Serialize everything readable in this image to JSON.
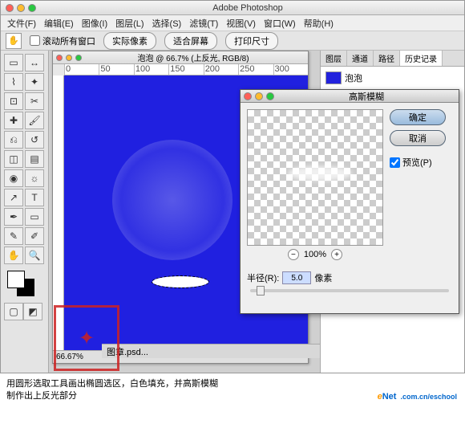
{
  "app": {
    "title": "Adobe Photoshop"
  },
  "menu": [
    "文件(F)",
    "编辑(E)",
    "图像(I)",
    "图层(L)",
    "选择(S)",
    "滤镜(T)",
    "视图(V)",
    "窗口(W)",
    "帮助(H)"
  ],
  "options": {
    "scroll_all": "滚动所有窗口",
    "actual_px": "实际像素",
    "fit_screen": "适合屏幕",
    "print_size": "打印尺寸"
  },
  "doc": {
    "title": "泡泡 @ 66.7% (上反光, RGB/8)",
    "ruler": [
      "0",
      "50",
      "100",
      "150",
      "200",
      "250",
      "300"
    ],
    "zoom_status": "66.67%",
    "tab": "图章.psd..."
  },
  "panels": {
    "tabs": [
      "图层",
      "通道",
      "路径",
      "历史记录"
    ],
    "hist_item": "泡泡"
  },
  "dialog": {
    "title": "高斯模糊",
    "ok": "确定",
    "cancel": "取消",
    "preview": "预览(P)",
    "zoom": "100%",
    "radius_label": "半径(R):",
    "radius_value": "5.0",
    "radius_unit": "像素"
  },
  "caption": {
    "line1": "用圆形选取工具画出椭圆选区，白色填充，并高斯模糊",
    "line2": "制作出上反光部分"
  },
  "logo": {
    "text1": "e",
    "text2": "Net",
    "sub": ".com.cn/eschool"
  },
  "icons": {
    "hand": "✋",
    "move": "↔",
    "marquee": "▭",
    "lasso": "⌇",
    "wand": "✦",
    "crop": "⊡",
    "slice": "✂",
    "heal": "✚",
    "brush": "🖌",
    "stamp": "⎌",
    "history": "↺",
    "eraser": "◫",
    "grad": "▤",
    "blur": "◉",
    "dodge": "☼",
    "pen": "✒",
    "type": "T",
    "path": "↗",
    "shape": "▭",
    "notes": "✎",
    "eyedrop": "✐",
    "zoom": "🔍"
  }
}
